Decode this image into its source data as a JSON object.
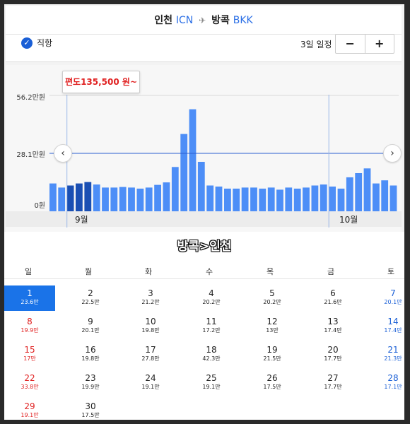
{
  "route": {
    "origin_name": "인천",
    "origin_code": "ICN",
    "dest_name": "방콕",
    "dest_code": "BKK",
    "direct_label": "직항",
    "stay_label": "3일 일정",
    "minus_label": "−",
    "plus_label": "+"
  },
  "chart": {
    "tooltip": "편도135,500 원~",
    "y_labels": [
      "56.2만원",
      "28.1만원",
      "0원"
    ],
    "month_labels": [
      "9월",
      "10월"
    ],
    "prev_icon": "chevron-left-icon",
    "next_icon": "chevron-right-icon"
  },
  "chart_data": {
    "type": "bar",
    "ylim": [
      0,
      56.2
    ],
    "y_ticks": [
      "0원",
      "28.1만원",
      "56.2만원"
    ],
    "reference_line": 28.1,
    "month_markers": [
      {
        "index": 2,
        "label": "9월"
      },
      {
        "index": 32,
        "label": "10월"
      }
    ],
    "selected_range": [
      2,
      4
    ],
    "values": [
      13.5,
      11.5,
      12.5,
      13.5,
      14.2,
      13.0,
      11.5,
      11.5,
      11.8,
      11.5,
      11.0,
      11.5,
      12.8,
      14.0,
      21.5,
      37.5,
      49.5,
      24.0,
      12.5,
      12.0,
      11.0,
      11.0,
      11.5,
      11.5,
      11.0,
      11.5,
      10.5,
      11.5,
      11.0,
      11.5,
      12.5,
      13.0,
      12.0,
      11.0,
      16.5,
      18.5,
      20.8,
      13.5,
      15.0,
      12.5
    ]
  },
  "calendar": {
    "title": "방콕>인천",
    "weekdays": [
      "일",
      "월",
      "화",
      "수",
      "목",
      "금",
      "토"
    ],
    "days": [
      {
        "d": "1",
        "p": "23.6만"
      },
      {
        "d": "2",
        "p": "22.5만"
      },
      {
        "d": "3",
        "p": "21.2만"
      },
      {
        "d": "4",
        "p": "20.2만"
      },
      {
        "d": "5",
        "p": "20.2만"
      },
      {
        "d": "6",
        "p": "21.6만"
      },
      {
        "d": "7",
        "p": "20.1만"
      },
      {
        "d": "8",
        "p": "19.9만"
      },
      {
        "d": "9",
        "p": "20.1만"
      },
      {
        "d": "10",
        "p": "19.8만"
      },
      {
        "d": "11",
        "p": "17.2만"
      },
      {
        "d": "12",
        "p": "13만"
      },
      {
        "d": "13",
        "p": "17.4만"
      },
      {
        "d": "14",
        "p": "17.4만"
      },
      {
        "d": "15",
        "p": "17만"
      },
      {
        "d": "16",
        "p": "19.8만"
      },
      {
        "d": "17",
        "p": "27.8만"
      },
      {
        "d": "18",
        "p": "42.3만"
      },
      {
        "d": "19",
        "p": "21.5만"
      },
      {
        "d": "20",
        "p": "17.7만"
      },
      {
        "d": "21",
        "p": "21.3만"
      },
      {
        "d": "22",
        "p": "33.8만"
      },
      {
        "d": "23",
        "p": "19.9만"
      },
      {
        "d": "24",
        "p": "19.1만"
      },
      {
        "d": "25",
        "p": "19.1만"
      },
      {
        "d": "26",
        "p": "17.5만"
      },
      {
        "d": "27",
        "p": "17.7만"
      },
      {
        "d": "28",
        "p": "17.1만"
      },
      {
        "d": "29",
        "p": "19.1만"
      },
      {
        "d": "30",
        "p": "17.5만"
      }
    ],
    "selected_day": "1"
  },
  "colors": {
    "accent": "#1a73e8",
    "bar": "#4d8ef7",
    "bar_selected": "#1a4fb3",
    "sunday": "#e02020",
    "saturday": "#1a5fd6"
  }
}
